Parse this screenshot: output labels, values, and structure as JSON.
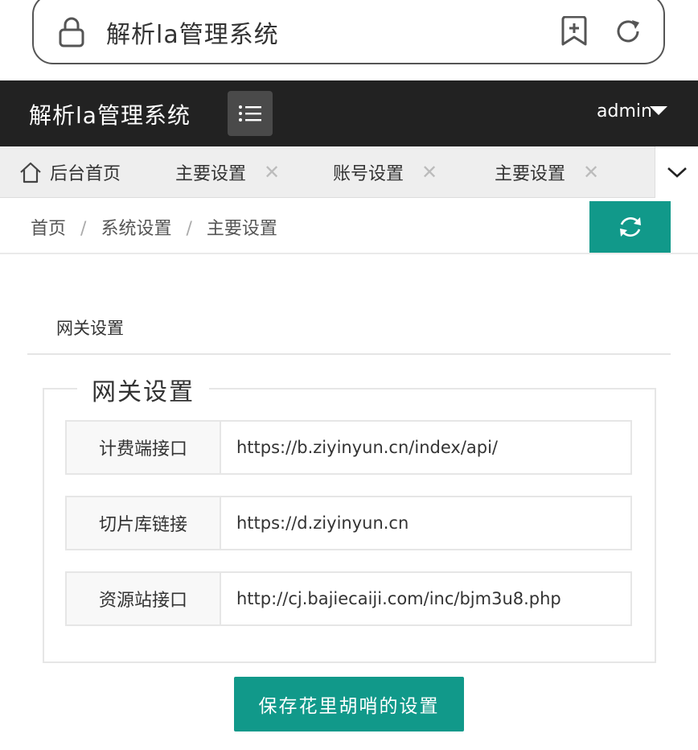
{
  "browser": {
    "title": "解析la管理系统"
  },
  "header": {
    "brand": "解析la管理系统",
    "user": "admin"
  },
  "tabs": [
    {
      "label": "后台首页",
      "closable": false
    },
    {
      "label": "主要设置",
      "closable": true
    },
    {
      "label": "账号设置",
      "closable": true
    },
    {
      "label": "主要设置",
      "closable": true
    }
  ],
  "tab_close_glyph": "✕",
  "breadcrumb": [
    "首页",
    "系统设置",
    "主要设置"
  ],
  "breadcrumb_sep": "/",
  "card": {
    "title": "网关设置",
    "legend": "网关设置"
  },
  "form": {
    "fields": [
      {
        "label": "计费端接口",
        "value": "https://b.ziyinyun.cn/index/api/"
      },
      {
        "label": "切片库链接",
        "value": "https://d.ziyinyun.cn"
      },
      {
        "label": "资源站接口",
        "value": "http://cj.bajiecaiji.com/inc/bjm3u8.php"
      }
    ],
    "save_label": "保存花里胡哨的设置"
  },
  "colors": {
    "header_bg": "#222222",
    "accent": "#11998a",
    "tabs_bg": "#eeeeee"
  },
  "icons": [
    "lock-icon",
    "bookmark-add-icon",
    "reload-icon",
    "menu-icon",
    "caret-down-icon",
    "home-icon",
    "close-icon",
    "chevron-down-icon",
    "refresh-icon"
  ]
}
